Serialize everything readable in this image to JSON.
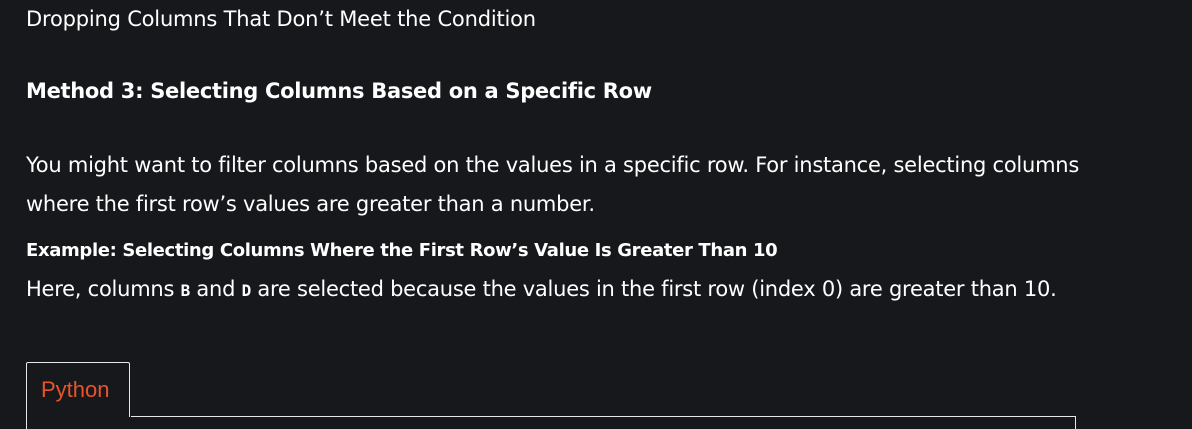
{
  "top_line": "Dropping Columns That Don’t Meet the Condition",
  "method_heading": "Method 3: Selecting Columns Based on a Specific Row",
  "paragraph": "You might want to filter columns based on the values in a specific row. For instance, selecting columns where the first row’s values are greater than a number.",
  "example_heading": "Example: Selecting Columns Where the First Row’s Value Is Greater Than 10",
  "paragraph2": {
    "before": "Here, columns ",
    "code1": "B",
    "between": " and ",
    "code2": "D",
    "after": " are selected because the values in the first row (index 0) are greater than 10."
  },
  "code_tabs": {
    "active_label": "Python"
  },
  "colors": {
    "background": "#17181c",
    "text": "#ffffff",
    "tab_accent": "#e8542a",
    "border": "#e6e6e6"
  }
}
